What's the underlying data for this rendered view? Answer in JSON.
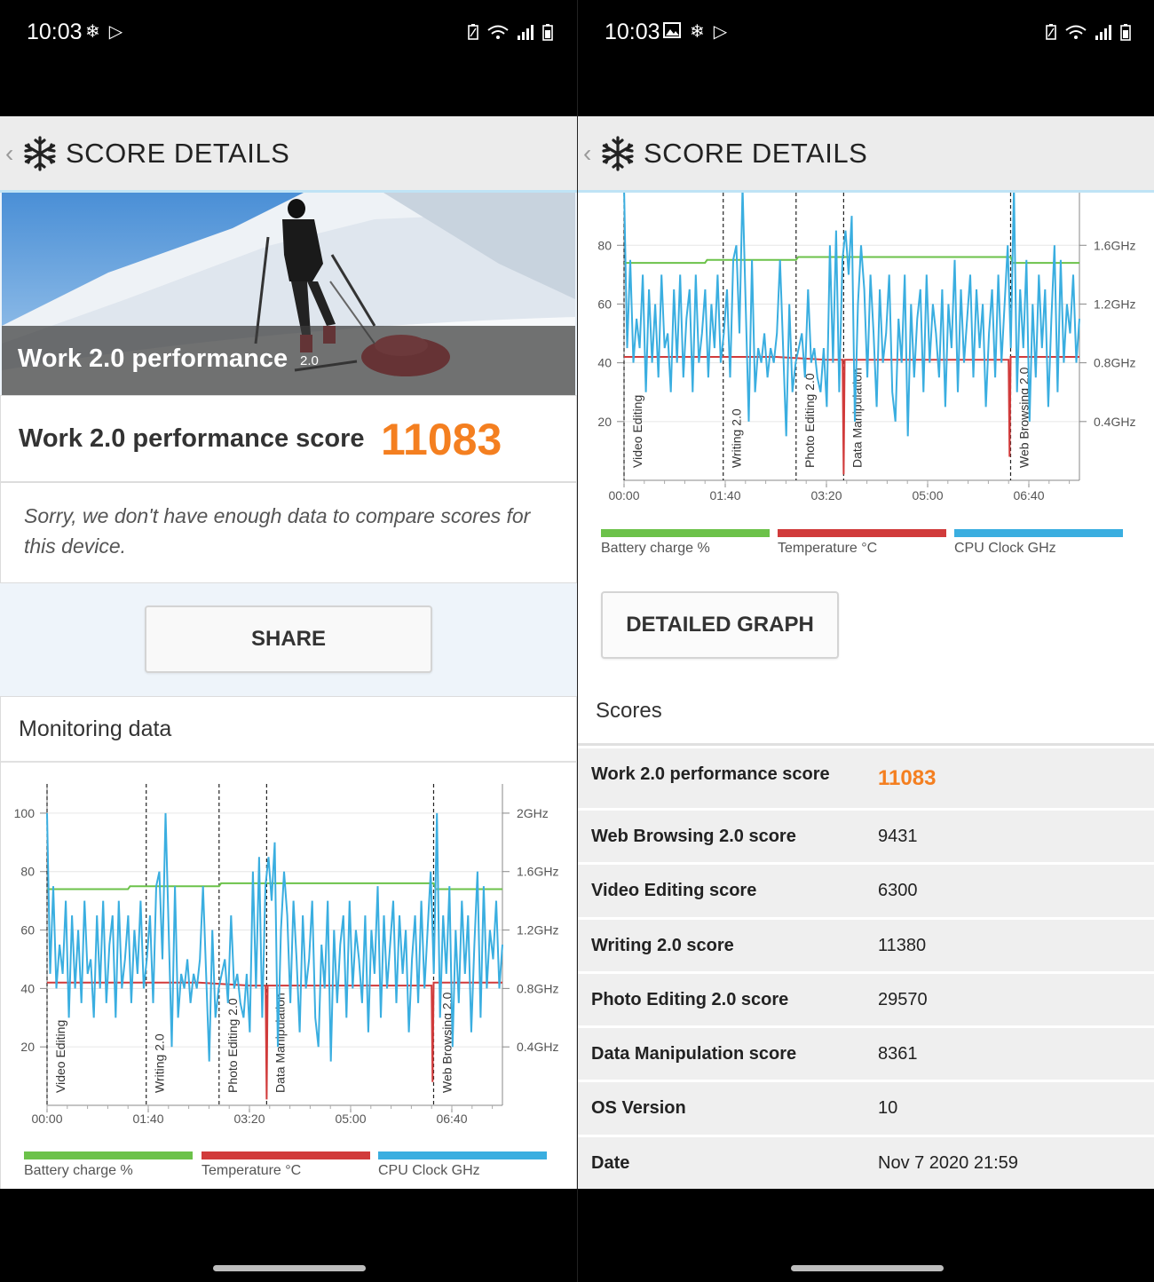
{
  "status_bar": {
    "time": "10:03",
    "left_icons_left": [
      "snowflake-icon",
      "play-store-icon"
    ],
    "left_icons_right": [
      "image-icon",
      "snowflake-icon",
      "play-store-icon"
    ],
    "right_icons": [
      "battery-saver-icon",
      "wifi-icon",
      "signal-icon",
      "battery-icon"
    ]
  },
  "header": {
    "title": "SCORE DETAILS"
  },
  "hero": {
    "title": "Work 2.0 performance",
    "version": "2.0"
  },
  "score": {
    "label": "Work 2.0 performance score",
    "value": "11083"
  },
  "notice": "Sorry, we don't have enough data to compare scores for this device.",
  "share_label": "SHARE",
  "monitoring_title": "Monitoring data",
  "legend": [
    {
      "label": "Battery charge %",
      "color": "#6cc24a"
    },
    {
      "label": "Temperature °C",
      "color": "#d13b3b"
    },
    {
      "label": "CPU Clock GHz",
      "color": "#3aaee0"
    }
  ],
  "detailed_graph_label": "DETAILED GRAPH",
  "scores_title": "Scores",
  "scores": [
    {
      "label": "Work 2.0 performance score",
      "value": "11083"
    },
    {
      "label": "Web Browsing 2.0 score",
      "value": "9431"
    },
    {
      "label": "Video Editing score",
      "value": "6300"
    },
    {
      "label": "Writing 2.0 score",
      "value": "11380"
    },
    {
      "label": "Photo Editing 2.0 score",
      "value": "29570"
    },
    {
      "label": "Data Manipulation score",
      "value": "8361"
    },
    {
      "label": "OS Version",
      "value": "10"
    },
    {
      "label": "Date",
      "value": "Nov 7 2020 21:59"
    }
  ],
  "chart_data": {
    "type": "line",
    "x_ticks": [
      "00:00",
      "01:40",
      "03:20",
      "05:00",
      "06:40"
    ],
    "x_range_seconds": [
      0,
      450
    ],
    "y_left_ticks": [
      20,
      40,
      60,
      80,
      100
    ],
    "y_left_range": [
      0,
      110
    ],
    "y_right_ticks": [
      "0.4GHz",
      "0.8GHz",
      "1.2GHz",
      "1.6GHz",
      "2GHz"
    ],
    "y_right_range_ghz": [
      0,
      2.2
    ],
    "phases": [
      {
        "label": "Video Editing",
        "start": 0
      },
      {
        "label": "Writing 2.0",
        "start": 98
      },
      {
        "label": "Photo Editing 2.0",
        "start": 170
      },
      {
        "label": "Data Manipulation",
        "start": 217
      },
      {
        "label": "Web Browsing 2.0",
        "start": 382
      }
    ],
    "series": [
      {
        "name": "Battery charge %",
        "color": "#6cc24a",
        "points": [
          [
            0,
            74
          ],
          [
            80,
            74
          ],
          [
            82,
            75
          ],
          [
            170,
            75
          ],
          [
            172,
            76
          ],
          [
            255,
            76
          ],
          [
            257,
            76
          ],
          [
            382,
            76
          ],
          [
            384,
            74
          ],
          [
            450,
            74
          ]
        ]
      },
      {
        "name": "Temperature °C",
        "color": "#d13b3b",
        "points": [
          [
            0,
            42
          ],
          [
            150,
            42
          ],
          [
            200,
            41
          ],
          [
            216,
            41
          ],
          [
            217,
            2
          ],
          [
            218,
            41
          ],
          [
            300,
            41
          ],
          [
            380,
            41
          ],
          [
            381,
            8
          ],
          [
            382,
            42
          ],
          [
            450,
            42
          ]
        ]
      },
      {
        "name": "CPU Clock GHz",
        "color": "#3aaee0",
        "values_ghz": [
          2.0,
          0.9,
          1.5,
          0.8,
          1.1,
          0.9,
          1.4,
          0.6,
          1.3,
          0.8,
          1.2,
          0.7,
          1.4,
          0.9,
          1.0,
          0.6,
          1.3,
          0.8,
          1.4,
          0.7,
          1.1,
          1.3,
          0.6,
          1.4,
          0.8,
          1.0,
          1.3,
          0.7,
          1.2,
          0.9,
          1.4,
          0.8,
          1.0,
          1.3,
          0.7,
          1.5,
          1.6,
          1.0,
          2.0,
          1.2,
          0.4,
          1.5,
          0.6,
          0.9,
          0.8,
          1.0,
          0.7,
          0.9,
          0.8,
          1.0,
          1.5,
          0.9,
          0.3,
          1.2,
          0.6,
          0.8,
          0.9,
          1.0,
          0.7,
          1.3,
          0.8,
          0.9,
          0.7,
          0.6,
          0.9,
          0.5,
          1.6,
          0.8,
          1.7,
          0.6,
          1.5,
          1.7,
          1.4,
          1.8,
          0.4,
          1.2,
          1.6,
          1.3,
          0.7,
          1.4,
          1.0,
          0.5,
          1.3,
          0.8,
          1.0,
          1.4,
          0.6,
          0.4,
          1.1,
          0.8,
          1.4,
          0.3,
          1.2,
          0.7,
          1.1,
          1.3,
          0.6,
          1.4,
          0.8,
          1.2,
          1.0,
          0.7,
          1.3,
          0.5,
          1.2,
          0.9,
          1.5,
          0.6,
          1.3,
          0.8,
          1.1,
          1.4,
          0.7,
          1.3,
          0.9,
          1.2,
          0.5,
          1.0,
          1.3,
          0.7,
          1.4,
          0.8,
          1.2,
          1.6,
          0.9,
          2.0,
          0.6,
          1.3,
          0.9,
          1.5,
          0.4,
          1.2,
          0.7,
          1.4,
          0.9,
          1.3,
          0.5,
          1.1,
          1.6,
          0.6,
          1.5,
          0.8,
          1.2,
          1.0,
          1.4,
          0.8,
          1.1
        ]
      }
    ]
  }
}
